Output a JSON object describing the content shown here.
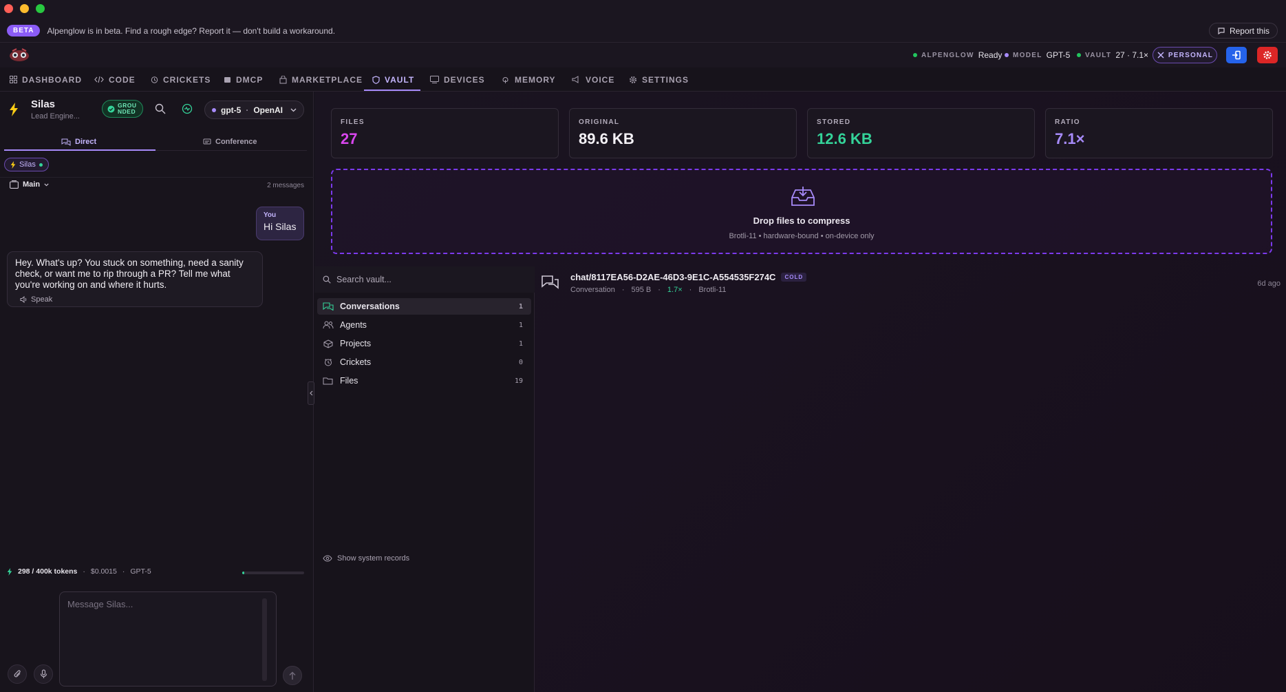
{
  "beta": {
    "pill": "BETA",
    "message": "Alpenglow is in beta. Find a rough edge? Report it — don't build a workaround.",
    "report_label": "Report this"
  },
  "header": {
    "status": {
      "alpenglow_label": "ALPENGLOW",
      "alpenglow_value": "Ready",
      "model_label": "MODEL",
      "model_value": "GPT-5",
      "vault_label": "VAULT",
      "vault_value": "27 · 7.1×"
    },
    "personal_label": "PERSONAL"
  },
  "nav": [
    {
      "label": "DASHBOARD",
      "icon": "dashboard-icon"
    },
    {
      "label": "CODE",
      "icon": "code-icon"
    },
    {
      "label": "CRICKETS",
      "icon": "crickets-icon"
    },
    {
      "label": "DMCP",
      "icon": "dmcp-icon"
    },
    {
      "label": "MARKETPLACE",
      "icon": "marketplace-icon"
    },
    {
      "label": "VAULT",
      "icon": "vault-icon",
      "active": true
    },
    {
      "label": "DEVICES",
      "icon": "devices-icon"
    },
    {
      "label": "MEMORY",
      "icon": "memory-icon"
    },
    {
      "label": "VOICE",
      "icon": "voice-icon"
    },
    {
      "label": "SETTINGS",
      "icon": "settings-icon"
    }
  ],
  "agent": {
    "name": "Silas",
    "role": "Lead Engine...",
    "grounded_line1": "GROU",
    "grounded_line2": "NDED",
    "model_name": "gpt-5",
    "model_provider": "OpenAI"
  },
  "chat": {
    "tabs": {
      "direct": "Direct",
      "conference": "Conference"
    },
    "chip": "Silas",
    "thread": "Main",
    "message_count": "2 messages",
    "messages": [
      {
        "author": "You",
        "text": "Hi Silas"
      },
      {
        "text": "Hey. What's up? You stuck on something, need a sanity check, or want me to rip through a PR? Tell me what you're working on and where it hurts.",
        "action": "Speak"
      }
    ],
    "usage": {
      "tokens": "298 / 400k tokens",
      "cost": "$0.0015",
      "model": "GPT-5",
      "fill_fraction": 0.03
    },
    "input_placeholder": "Message Silas..."
  },
  "vault": {
    "stats": [
      {
        "label": "FILES",
        "value": "27",
        "color": "#d946ef"
      },
      {
        "label": "ORIGINAL",
        "value": "89.6 KB",
        "color": "#f4f1f6"
      },
      {
        "label": "STORED",
        "value": "12.6 KB",
        "color": "#34d399"
      },
      {
        "label": "RATIO",
        "value": "7.1×",
        "color": "#a78bfa"
      }
    ],
    "drop_title": "Drop files to compress",
    "drop_subtitle": "Brotli-11 • hardware-bound • on-device only",
    "search_placeholder": "Search vault...",
    "categories": [
      {
        "label": "Conversations",
        "count": "1",
        "icon": "conversations-icon",
        "active": true
      },
      {
        "label": "Agents",
        "count": "1",
        "icon": "agents-icon"
      },
      {
        "label": "Projects",
        "count": "1",
        "icon": "projects-icon"
      },
      {
        "label": "Crickets",
        "count": "0",
        "icon": "crickets-icon"
      },
      {
        "label": "Files",
        "count": "19",
        "icon": "files-icon"
      }
    ],
    "show_system": "Show system records",
    "records": [
      {
        "title": "chat/8117EA56-D2AE-46D3-9E1C-A554535F274C",
        "badge": "COLD",
        "type": "Conversation",
        "size": "595 B",
        "ratio": "1.7×",
        "codec": "Brotli-11",
        "time": "6d ago"
      }
    ]
  },
  "colors": {
    "accent": "#a78bfa",
    "green": "#22c55e",
    "stored": "#34d399",
    "files": "#d946ef"
  }
}
